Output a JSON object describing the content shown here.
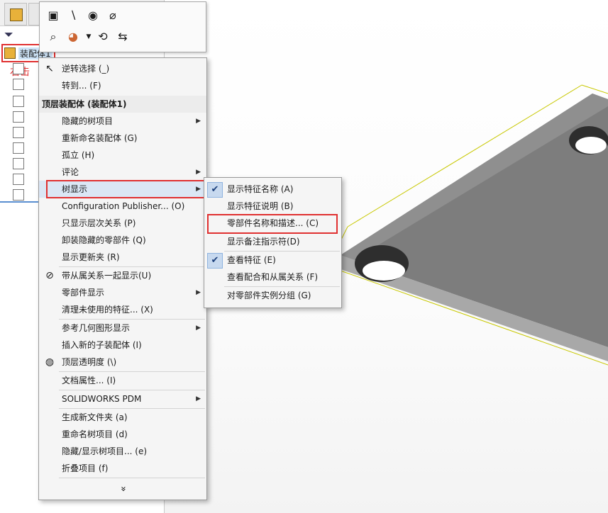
{
  "tree": {
    "root_label": "装配体1",
    "annotation_label": "右击"
  },
  "context_menu": {
    "items": [
      {
        "label": "逆转选择 (_)",
        "icon": "cursor-arrow-icon",
        "submenu": false
      },
      {
        "label": "转到... (F)",
        "submenu": false
      }
    ],
    "header": "顶层装配体 (装配体1)",
    "group_items": [
      {
        "label": "隐藏的树项目",
        "submenu": true
      },
      {
        "label": "重新命名装配体 (G)",
        "submenu": false
      },
      {
        "label": "孤立 (H)",
        "submenu": false
      },
      {
        "label": "评论",
        "submenu": true
      },
      {
        "label": "树显示",
        "submenu": true
      },
      {
        "label": "Configuration Publisher... (O)",
        "submenu": false
      },
      {
        "label": "只显示层次关系 (P)",
        "submenu": false
      },
      {
        "label": "卸装隐藏的零部件 (Q)",
        "submenu": false
      },
      {
        "label": "显示更新夹 (R)",
        "submenu": false
      }
    ],
    "group2_items": [
      {
        "label": "带从属关系一起显示(U)",
        "icon": "hide-show-icon",
        "submenu": false
      },
      {
        "label": "零部件显示",
        "submenu": true
      },
      {
        "label": "清理未使用的特征... (X)",
        "submenu": false
      }
    ],
    "group3_items": [
      {
        "label": "参考几何图形显示",
        "submenu": true
      },
      {
        "label": "插入新的子装配体 (I)",
        "submenu": false
      },
      {
        "label": "顶层透明度 (\\)",
        "icon": "transparency-icon",
        "submenu": false
      }
    ],
    "group4_items": [
      {
        "label": "文档属性... (I)",
        "submenu": false
      }
    ],
    "group5_items": [
      {
        "label": "SOLIDWORKS PDM",
        "submenu": true
      }
    ],
    "group6_items": [
      {
        "label": "生成新文件夹 (a)",
        "submenu": false
      },
      {
        "label": "重命名树项目 (d)",
        "submenu": false
      },
      {
        "label": "隐藏/显示树项目... (e)",
        "submenu": false
      },
      {
        "label": "折叠项目 (f)",
        "submenu": false
      }
    ],
    "more_label": "»"
  },
  "submenu": {
    "items": [
      {
        "label": "显示特征名称 (A)",
        "checked": true
      },
      {
        "label": "显示特征说明 (B)",
        "checked": false
      },
      {
        "label": "零部件名称和描述... (C)",
        "checked": false
      },
      {
        "label": "显示备注指示符(D)",
        "checked": false
      },
      {
        "label": "查看特征 (E)",
        "checked": true
      },
      {
        "label": "查看配合和从属关系 (F)",
        "checked": false
      },
      {
        "label": "对零部件实例分组 (G)",
        "checked": false
      }
    ]
  },
  "colors": {
    "highlight_red": "#e03030",
    "part_gray": "#8a8a8a",
    "edge_yellow": "#c8c800"
  }
}
